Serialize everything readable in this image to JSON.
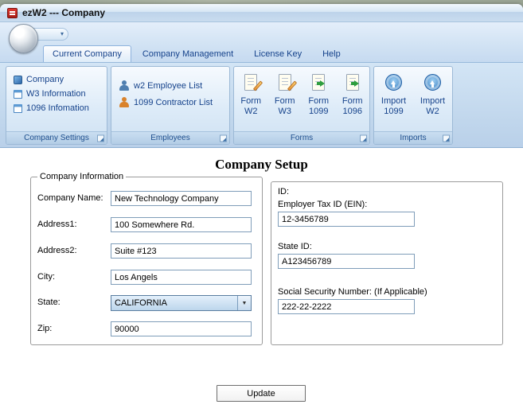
{
  "theme": {
    "accent_blue": "#15428b",
    "ribbon_bg": "#c9ddf2",
    "titlebar_bg": "#cfe1f3",
    "group_caption_bg": "#bcd3ea",
    "content_bg": "#ffffff",
    "app_icon_red": "#c2261e"
  },
  "window": {
    "title": "ezW2 --- Company"
  },
  "icons": {
    "qat_dropdown": "▾",
    "combo_arrow": "▼"
  },
  "ribbon": {
    "tabs": [
      {
        "label": "Current Company",
        "active": true
      },
      {
        "label": "Company Management",
        "active": false
      },
      {
        "label": "License Key",
        "active": false
      },
      {
        "label": "Help",
        "active": false
      }
    ],
    "groups": [
      {
        "label": "Company Settings",
        "items": [
          {
            "label": "Company"
          },
          {
            "label": "W3 Information"
          },
          {
            "label": "1096 Infomation"
          }
        ]
      },
      {
        "label": "Employees",
        "items": [
          {
            "label": "w2 Employee List"
          },
          {
            "label": "1099 Contractor List"
          }
        ]
      },
      {
        "label": "Forms",
        "items": [
          {
            "line1": "Form",
            "line2": "W2"
          },
          {
            "line1": "Form",
            "line2": "W3"
          },
          {
            "line1": "Form",
            "line2": "1099"
          },
          {
            "line1": "Form",
            "line2": "1096"
          }
        ]
      },
      {
        "label": "Imports",
        "items": [
          {
            "line1": "Import",
            "line2": "1099"
          },
          {
            "line1": "Import",
            "line2": "W2"
          }
        ]
      }
    ]
  },
  "main": {
    "heading": "Company Setup",
    "company_info": {
      "legend": "Company Information",
      "fields": [
        {
          "label": "Company Name:",
          "value": "New Technology Company"
        },
        {
          "label": "Address1:",
          "value": "100 Somewhere Rd."
        },
        {
          "label": "Address2:",
          "value": "Suite #123"
        },
        {
          "label": "City:",
          "value": "Los Angels"
        },
        {
          "label": "State:",
          "value": "CALIFORNIA"
        },
        {
          "label": "Zip:",
          "value": "90000"
        }
      ]
    },
    "id_section": {
      "heading": "ID:",
      "fields": [
        {
          "label": "Employer Tax ID (EIN):",
          "value": "12-3456789"
        },
        {
          "label": "State ID:",
          "value": "A123456789"
        },
        {
          "label": "Social Security Number: (If Applicable)",
          "value": "222-22-2222"
        }
      ]
    },
    "update_button": "Update"
  }
}
